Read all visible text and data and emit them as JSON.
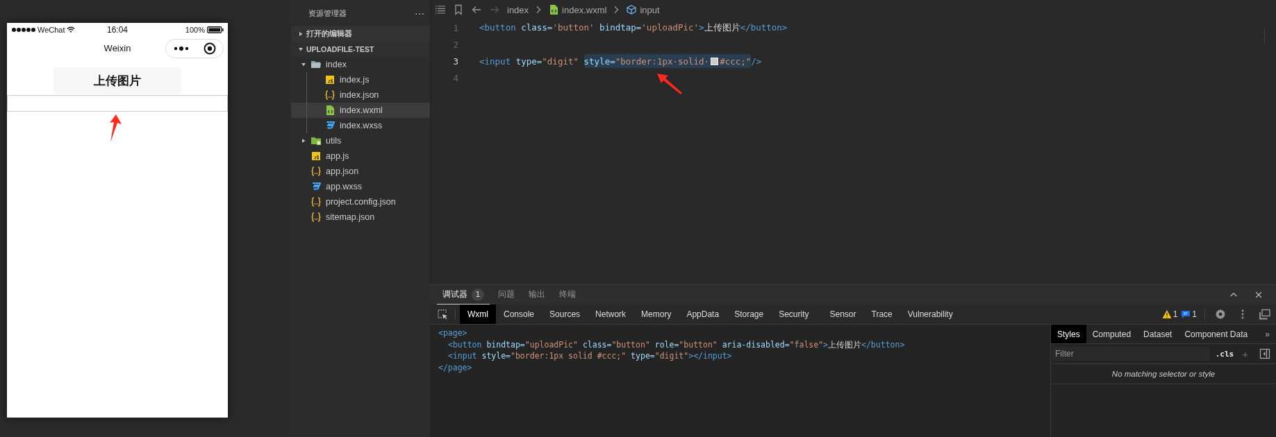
{
  "simulator": {
    "status_bar": {
      "carrier": "WeChat",
      "time": "16:04",
      "battery": "100%"
    },
    "nav_title": "Weixin",
    "button": "上传图片"
  },
  "explorer": {
    "title": "资源管理器",
    "more": "···",
    "sections": [
      {
        "label": "打开的编辑器",
        "expanded": false
      },
      {
        "label": "UPLOADFILE-TEST",
        "expanded": true
      }
    ],
    "tree": [
      {
        "label": "index",
        "kind": "folder",
        "expanded": true,
        "selected": false,
        "children": [
          {
            "label": "index.js",
            "kind": "js",
            "selected": false
          },
          {
            "label": "index.json",
            "kind": "json",
            "selected": false
          },
          {
            "label": "index.wxml",
            "kind": "wxml",
            "selected": true
          },
          {
            "label": "index.wxss",
            "kind": "wxss",
            "selected": false
          }
        ]
      },
      {
        "label": "utils",
        "kind": "folder-plus",
        "expanded": false,
        "selected": false
      },
      {
        "label": "app.js",
        "kind": "js",
        "selected": false
      },
      {
        "label": "app.json",
        "kind": "json",
        "selected": false
      },
      {
        "label": "app.wxss",
        "kind": "wxss",
        "selected": false
      },
      {
        "label": "project.config.json",
        "kind": "json",
        "selected": false
      },
      {
        "label": "sitemap.json",
        "kind": "json",
        "selected": false
      }
    ]
  },
  "editor": {
    "breadcrumb": [
      {
        "label": "index",
        "kind": "folder"
      },
      {
        "label": "index.wxml",
        "kind": "wxml"
      },
      {
        "label": "input",
        "kind": "element"
      }
    ],
    "lines": [
      {
        "number": "1",
        "current": false,
        "groups": [
          {
            "selected": false,
            "parts": [
              {
                "kind": "code",
                "tokens": [
                  {
                    "kind": "tag",
                    "text": "<button"
                  },
                  {
                    "kind": "attr",
                    "text": " class="
                  },
                  {
                    "kind": "str",
                    "text": "'button'"
                  },
                  {
                    "kind": "attr",
                    "text": " bindtap="
                  },
                  {
                    "kind": "str",
                    "text": "'uploadPic'"
                  },
                  {
                    "kind": "tag",
                    "text": ">"
                  },
                  {
                    "kind": "plain",
                    "text": "上传图片"
                  },
                  {
                    "kind": "tag",
                    "text": "</button>"
                  }
                ]
              }
            ]
          }
        ]
      },
      {
        "number": "2",
        "current": false
      },
      {
        "number": "3",
        "current": true,
        "groups": [
          {
            "selected": false,
            "parts": [
              {
                "kind": "code",
                "tokens": [
                  {
                    "kind": "tag",
                    "text": "<input"
                  },
                  {
                    "kind": "attr",
                    "text": " type="
                  },
                  {
                    "kind": "str",
                    "text": "\"digit\" "
                  }
                ]
              }
            ]
          },
          {
            "selected": true,
            "parts": [
              {
                "kind": "code",
                "tokens": [
                  {
                    "kind": "attr",
                    "text": "style="
                  },
                  {
                    "kind": "str",
                    "text": "\"border:1px·solid·"
                  }
                ]
              },
              {
                "kind": "swatch"
              },
              {
                "kind": "code",
                "tokens": [
                  {
                    "kind": "str",
                    "text": "#ccc;\""
                  }
                ]
              }
            ]
          },
          {
            "selected": false,
            "parts": [
              {
                "kind": "code",
                "tokens": [
                  {
                    "kind": "tag",
                    "text": "/>"
                  }
                ]
              }
            ]
          }
        ]
      },
      {
        "number": "4",
        "current": false
      }
    ]
  },
  "devtools": {
    "panel_tabs": [
      {
        "label": "调试器",
        "badge": "1",
        "selected": true
      },
      {
        "label": "问题",
        "selected": false
      },
      {
        "label": "输出",
        "selected": false
      },
      {
        "label": "终端",
        "selected": false
      }
    ],
    "tool_tabs": [
      {
        "label": "Wxml",
        "selected": true
      },
      {
        "label": "Console",
        "selected": false
      },
      {
        "label": "Sources",
        "selected": false
      },
      {
        "label": "Network",
        "selected": false
      },
      {
        "label": "Memory",
        "selected": false
      },
      {
        "label": "AppData",
        "selected": false
      },
      {
        "label": "Storage",
        "selected": false
      },
      {
        "label": "Security",
        "selected": false
      },
      {
        "label": "Sensor",
        "selected": false
      },
      {
        "label": "Trace",
        "selected": false
      },
      {
        "label": "Vulnerability",
        "selected": false
      }
    ],
    "warnings": "1",
    "messages": "1",
    "wxml": {
      "open": [
        {
          "kind": "tag",
          "text": "<page>"
        }
      ],
      "children": [
        {
          "tokens": [
            {
              "kind": "tag",
              "text": "<button"
            },
            {
              "kind": "attr",
              "text": " bindtap="
            },
            {
              "kind": "str",
              "text": "\"uploadPic\""
            },
            {
              "kind": "attr",
              "text": " class="
            },
            {
              "kind": "str",
              "text": "\"button\""
            },
            {
              "kind": "attr",
              "text": " role="
            },
            {
              "kind": "str",
              "text": "\"button\""
            },
            {
              "kind": "attr",
              "text": " aria-disabled="
            },
            {
              "kind": "str",
              "text": "\"false\""
            },
            {
              "kind": "tag",
              "text": ">"
            },
            {
              "kind": "plain",
              "text": "上传图片"
            },
            {
              "kind": "tag",
              "text": "</button>"
            }
          ]
        },
        {
          "tokens": [
            {
              "kind": "tag",
              "text": "<input"
            },
            {
              "kind": "attr",
              "text": " style="
            },
            {
              "kind": "str",
              "text": "\"border:1px solid #ccc;\""
            },
            {
              "kind": "attr",
              "text": " type="
            },
            {
              "kind": "str",
              "text": "\"digit\""
            },
            {
              "kind": "tag",
              "text": "></input>"
            }
          ]
        }
      ],
      "close": [
        {
          "kind": "tag",
          "text": "</page>"
        }
      ]
    },
    "styles_tabs": [
      {
        "label": "Styles",
        "selected": true
      },
      {
        "label": "Computed",
        "selected": false
      },
      {
        "label": "Dataset",
        "selected": false
      },
      {
        "label": "Component Data",
        "selected": false
      }
    ],
    "more_tabs": "»",
    "filter_placeholder": "Filter",
    "cls": ".cls",
    "add": "+",
    "empty_message": "No matching selector or style"
  }
}
